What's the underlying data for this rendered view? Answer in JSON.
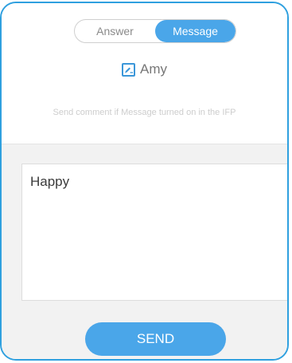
{
  "tabs": [
    {
      "label": "Answer",
      "active": false
    },
    {
      "label": "Message",
      "active": true
    }
  ],
  "user": {
    "name": "Amy",
    "icon": "edit-icon"
  },
  "hint": "Send comment if Message turned on in the IFP",
  "message": {
    "value": "Happy"
  },
  "send_label": "SEND",
  "colors": {
    "accent": "#4aa6e9",
    "frame_border": "#2fa0df",
    "bottom_bg": "#f2f2f2"
  }
}
